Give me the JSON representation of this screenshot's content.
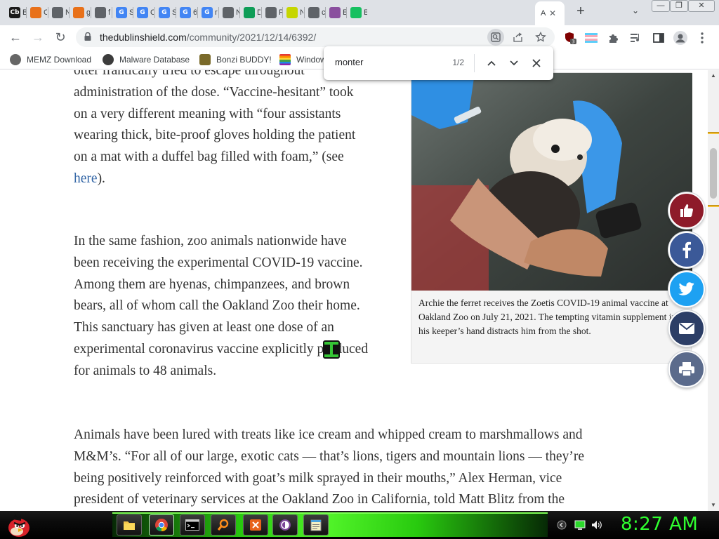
{
  "browser": {
    "tabs": [
      {
        "favicon_text": "Cb",
        "title": "B",
        "color": "#1a1a1a"
      },
      {
        "favicon_text": "",
        "title": "C",
        "color": "#e8711a"
      },
      {
        "favicon_text": "",
        "title": "N",
        "color": "#5f6368"
      },
      {
        "favicon_text": "",
        "title": "g",
        "color": "#e8711a"
      },
      {
        "favicon_text": "",
        "title": "f",
        "color": "#5f6368"
      },
      {
        "favicon_text": "G",
        "title": "S",
        "color": "#4285f4"
      },
      {
        "favicon_text": "G",
        "title": "C",
        "color": "#4285f4"
      },
      {
        "favicon_text": "G",
        "title": "S",
        "color": "#4285f4"
      },
      {
        "favicon_text": "G",
        "title": "6",
        "color": "#4285f4"
      },
      {
        "favicon_text": "G",
        "title": "r",
        "color": "#4285f4"
      },
      {
        "favicon_text": "",
        "title": "N",
        "color": "#5f6368"
      },
      {
        "favicon_text": "",
        "title": "D",
        "color": "#0f9d58"
      },
      {
        "favicon_text": "",
        "title": "P",
        "color": "#5f6368"
      },
      {
        "favicon_text": "",
        "title": "N",
        "color": "#c6d600"
      },
      {
        "favicon_text": "",
        "title": "c",
        "color": "#5f6368"
      },
      {
        "favicon_text": "",
        "title": "E",
        "color": "#8a4f9e"
      },
      {
        "favicon_text": "",
        "title": "E",
        "color": "#16c060"
      }
    ],
    "active_tab": {
      "title": "A",
      "close": "✕"
    },
    "new_tab": "+",
    "tab_search": "⌄",
    "window_controls": {
      "minimize": "—",
      "restore": "❐",
      "close": "✕"
    },
    "nav": {
      "back": "←",
      "forward": "→",
      "reload": "↻"
    },
    "address": {
      "domain": "thedublinshield.com",
      "path": "/community/2021/12/14/6392/"
    },
    "extension_badge": "3",
    "bookmarks": [
      {
        "label": "MEMZ Download",
        "icon_color": "#606060"
      },
      {
        "label": "Malware Database",
        "icon_color": "#404040"
      },
      {
        "label": "Bonzi BUDDY!",
        "icon_color": "#7b3f9e"
      },
      {
        "label": "Window",
        "icon_color": "#d03030"
      }
    ]
  },
  "find_bar": {
    "query": "monter",
    "count": "1/2",
    "prev": "⌃",
    "next": "⌄",
    "close": "✕"
  },
  "article": {
    "p1_lines": [
      "otter frantically tried to escape throughout",
      "administration of the dose. “Vaccine-hesitant” took",
      "on a very different meaning with “four assistants",
      "wearing thick, bite-proof gloves holding the patient",
      "on a mat with a duffel bag filled with foam,” (see"
    ],
    "p1_link": "here",
    "p1_end": ").",
    "p2_lines": [
      "In the same fashion, zoo animals nationwide have",
      "been receiving the experimental COVID-19 vaccine.",
      "Among them are hyenas, chimpanzees, and brown",
      "bears, all of whom call the Oakland Zoo their home.",
      "This sanctuary has given at least one dose of an",
      "experimental coronavirus vaccine explicitly produced",
      "for animals to 48 animals."
    ],
    "p3_lines": [
      "Animals have been lured with treats like ice cream and whipped cream to marshmallows and",
      "M&M’s. “For all of our large, exotic cats — that’s lions, tigers and mountain lions — they’re",
      "being positively reinforced with goat’s milk sprayed in their mouths,” Alex Herman, vice",
      "president of veterinary services at the Oakland Zoo in California, told Matt Blitz from the"
    ],
    "caption": "Archie the ferret receives the Zoetis COVID-19 animal vaccine at Oakland Zoo on July 21, 2021. The tempting vitamin supplement in his keeper’s hand distracts him from the shot."
  },
  "share": [
    {
      "name": "like",
      "color": "#8e1b2a"
    },
    {
      "name": "facebook",
      "color": "#3b5998"
    },
    {
      "name": "twitter",
      "color": "#1da1f2"
    },
    {
      "name": "email",
      "color": "#2c3e66"
    },
    {
      "name": "print",
      "color": "#5b6b8c"
    }
  ],
  "taskbar": {
    "clock": "8:27 AM",
    "apps": [
      "file-explorer",
      "chrome",
      "command-prompt",
      "search",
      "office",
      "tor-browser",
      "notepad"
    ]
  }
}
